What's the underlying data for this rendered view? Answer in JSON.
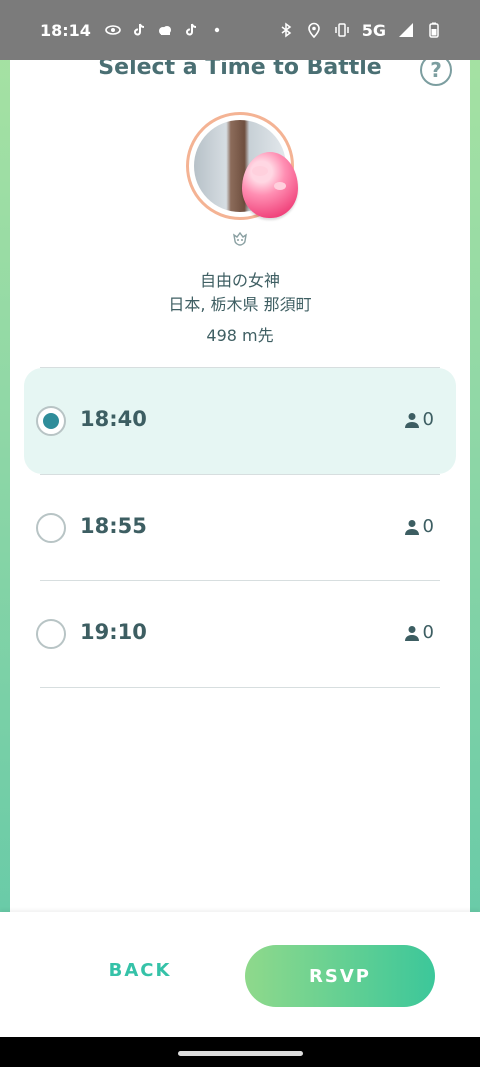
{
  "status_bar": {
    "time": "18:14",
    "left_icons": [
      "eye-icon",
      "tiktok-icon",
      "weather-icon",
      "tiktok-icon",
      "dot-icon"
    ],
    "right_icons": [
      "bluetooth-icon",
      "location-icon",
      "vibrate-icon"
    ],
    "network": "5G",
    "signal_icon": "signal-icon",
    "battery_icon": "battery-icon"
  },
  "header": {
    "title": "Select a Time to Battle",
    "help_label": "?"
  },
  "gym": {
    "name": "自由の女神",
    "location": "日本, 栃木県 那須町",
    "distance": "498 m先"
  },
  "time_slots": [
    {
      "time": "18:40",
      "count": "0",
      "selected": true
    },
    {
      "time": "18:55",
      "count": "0",
      "selected": false
    },
    {
      "time": "19:10",
      "count": "0",
      "selected": false
    }
  ],
  "actions": {
    "back_label": "BACK",
    "rsvp_label": "RSVP"
  },
  "colors": {
    "accent": "#35c2a8",
    "selected_bg": "#e6f6f3",
    "radio_on": "#2f8d9a",
    "text": "#3d5e62"
  }
}
